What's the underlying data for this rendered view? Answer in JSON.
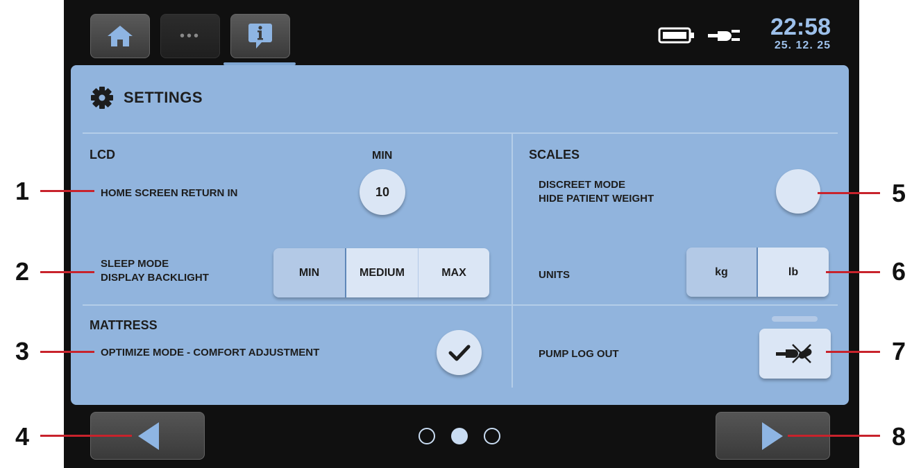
{
  "topbar": {
    "home_icon": "home-icon",
    "more_icon": "more-dots-icon",
    "more_label": "•••",
    "info_icon": "info-icon",
    "battery_icon": "battery-icon",
    "plug_icon": "power-plug-icon",
    "time": "22:58",
    "date": "25. 12. 25"
  },
  "panel": {
    "title_icon": "gear-icon",
    "title": "SETTINGS",
    "lcd": {
      "heading": "LCD",
      "min_header": "MIN",
      "home_return_label": "HOME SCREEN RETURN IN",
      "home_return_value": "10",
      "sleep_label_line1": "SLEEP MODE",
      "sleep_label_line2": "DISPLAY BACKLIGHT",
      "backlight_options": [
        "MIN",
        "MEDIUM",
        "MAX"
      ],
      "backlight_selected": "MEDIUM"
    },
    "scales": {
      "heading": "SCALES",
      "discreet_line1": "DISCREET MODE",
      "discreet_line2": "HIDE PATIENT WEIGHT",
      "units_label": "UNITS",
      "unit_options": [
        "kg",
        "lb"
      ],
      "unit_selected": "lb"
    },
    "mattress": {
      "heading": "MATTRESS",
      "optimize_label": "OPTIMIZE MODE - COMFORT ADJUSTMENT",
      "optimize_icon": "checkmark-icon"
    },
    "pump": {
      "label": "PUMP LOG OUT",
      "icon": "pump-logout-icon"
    }
  },
  "bottom": {
    "prev_icon": "arrow-left-icon",
    "next_icon": "arrow-right-icon",
    "page_count": 3,
    "current_page": 2
  },
  "annotations": [
    "1",
    "2",
    "3",
    "4",
    "5",
    "6",
    "7",
    "8"
  ],
  "colors": {
    "panel": "#91b4dd",
    "button_light": "#dbe6f5",
    "button_off": "#b3c9e6",
    "accent_text": "#9dc0ea",
    "callout_line": "#c8232c"
  }
}
